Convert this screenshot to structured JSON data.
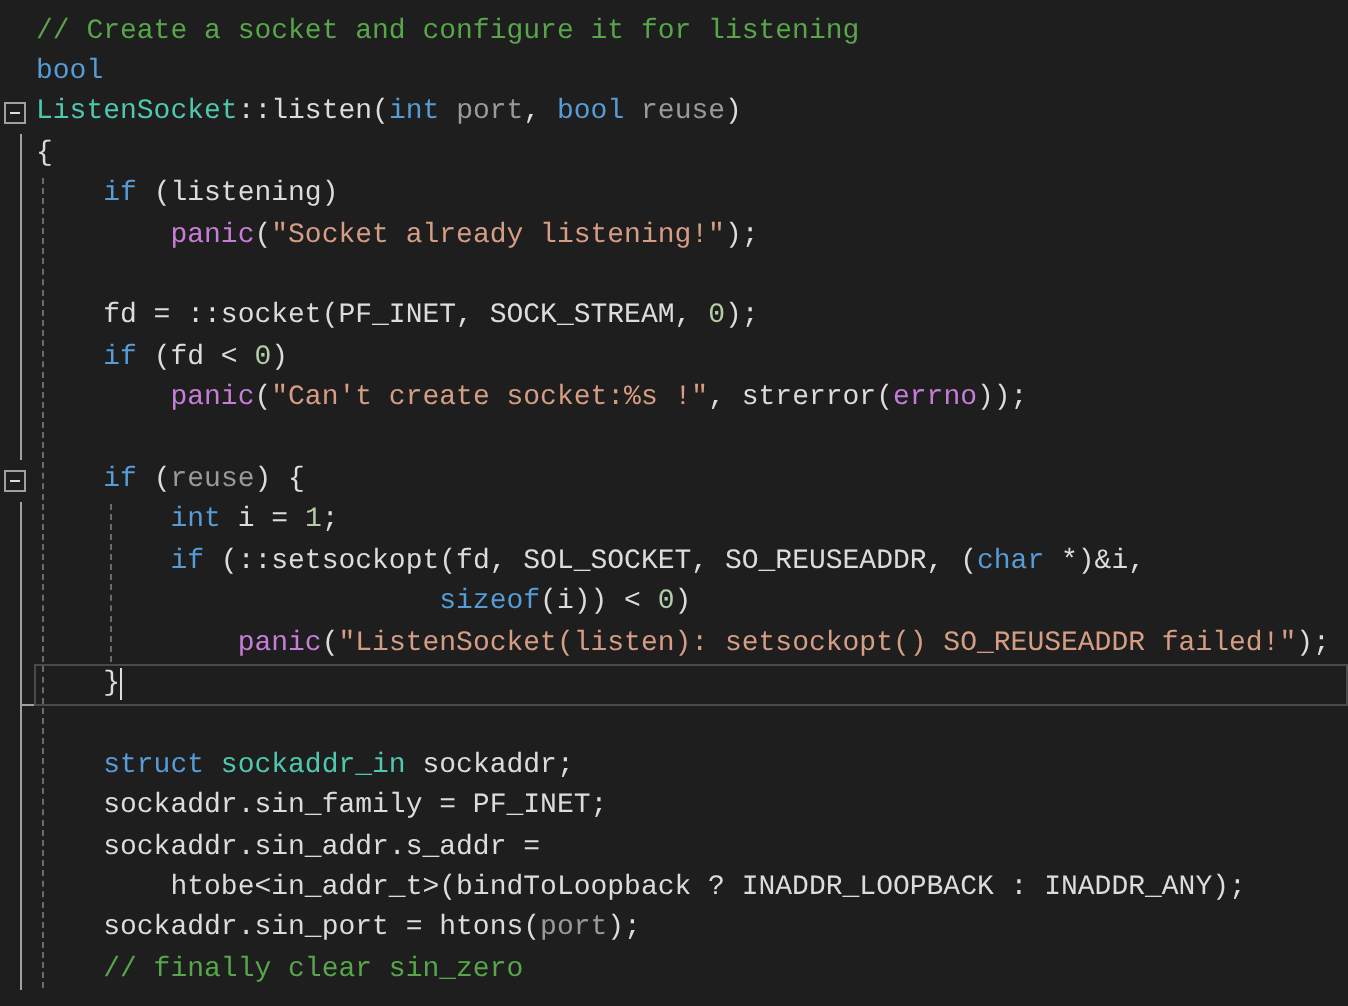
{
  "editor": {
    "lines": [
      {
        "tokens": [
          {
            "kind": "comment",
            "text": "// Create a socket and configure it for listening"
          }
        ]
      },
      {
        "tokens": [
          {
            "kind": "keyword",
            "text": "bool"
          }
        ]
      },
      {
        "fold_start": true,
        "tokens": [
          {
            "kind": "type",
            "text": "ListenSocket"
          },
          {
            "kind": "plain",
            "text": "::listen("
          },
          {
            "kind": "keyword",
            "text": "int"
          },
          {
            "kind": "param",
            "text": " port"
          },
          {
            "kind": "plain",
            "text": ", "
          },
          {
            "kind": "keyword",
            "text": "bool"
          },
          {
            "kind": "param",
            "text": " reuse"
          },
          {
            "kind": "plain",
            "text": ")"
          }
        ]
      },
      {
        "tokens": [
          {
            "kind": "plain",
            "text": "{"
          }
        ]
      },
      {
        "tokens": [
          {
            "kind": "keyword",
            "text": "    if"
          },
          {
            "kind": "plain",
            "text": " (listening)"
          }
        ]
      },
      {
        "tokens": [
          {
            "kind": "call",
            "text": "        panic"
          },
          {
            "kind": "plain",
            "text": "("
          },
          {
            "kind": "string",
            "text": "\"Socket already listening!\""
          },
          {
            "kind": "plain",
            "text": ");"
          }
        ]
      },
      {
        "blank": true
      },
      {
        "tokens": [
          {
            "kind": "plain",
            "text": "    fd = ::socket(PF_INET, SOCK_STREAM, "
          },
          {
            "kind": "number",
            "text": "0"
          },
          {
            "kind": "plain",
            "text": ");"
          }
        ]
      },
      {
        "tokens": [
          {
            "kind": "keyword",
            "text": "    if"
          },
          {
            "kind": "plain",
            "text": " (fd < "
          },
          {
            "kind": "number",
            "text": "0"
          },
          {
            "kind": "plain",
            "text": ")"
          }
        ]
      },
      {
        "tokens": [
          {
            "kind": "call",
            "text": "        panic"
          },
          {
            "kind": "plain",
            "text": "("
          },
          {
            "kind": "string",
            "text": "\"Can't create socket:%s !\""
          },
          {
            "kind": "plain",
            "text": ", strerror("
          },
          {
            "kind": "call",
            "text": "errno"
          },
          {
            "kind": "plain",
            "text": "));"
          }
        ]
      },
      {
        "blank": true
      },
      {
        "fold_start": true,
        "tokens": [
          {
            "kind": "keyword",
            "text": "    if"
          },
          {
            "kind": "plain",
            "text": " ("
          },
          {
            "kind": "param",
            "text": "reuse"
          },
          {
            "kind": "plain",
            "text": ") {"
          }
        ]
      },
      {
        "tokens": [
          {
            "kind": "keyword",
            "text": "        int"
          },
          {
            "kind": "plain",
            "text": " i = "
          },
          {
            "kind": "number",
            "text": "1"
          },
          {
            "kind": "plain",
            "text": ";"
          }
        ]
      },
      {
        "tokens": [
          {
            "kind": "keyword",
            "text": "        if"
          },
          {
            "kind": "plain",
            "text": " (::setsockopt(fd, SOL_SOCKET, SO_REUSEADDR, ("
          },
          {
            "kind": "keyword",
            "text": "char"
          },
          {
            "kind": "plain",
            "text": " *)&i,"
          }
        ]
      },
      {
        "tokens": [
          {
            "kind": "keyword",
            "text": "                        sizeof"
          },
          {
            "kind": "plain",
            "text": "(i)) < "
          },
          {
            "kind": "number",
            "text": "0"
          },
          {
            "kind": "plain",
            "text": ")"
          }
        ]
      },
      {
        "tokens": [
          {
            "kind": "call",
            "text": "            panic"
          },
          {
            "kind": "plain",
            "text": "("
          },
          {
            "kind": "string",
            "text": "\"ListenSocket(listen): setsockopt() SO_REUSEADDR failed!\""
          },
          {
            "kind": "plain",
            "text": ");"
          }
        ]
      },
      {
        "fold_end": true,
        "current": true,
        "tokens": [
          {
            "kind": "plain",
            "text": "    }"
          }
        ]
      },
      {
        "blank": true
      },
      {
        "tokens": [
          {
            "kind": "keyword",
            "text": "    struct"
          },
          {
            "kind": "type",
            "text": " sockaddr_in"
          },
          {
            "kind": "plain",
            "text": " sockaddr;"
          }
        ]
      },
      {
        "tokens": [
          {
            "kind": "plain",
            "text": "    sockaddr.sin_family = PF_INET;"
          }
        ]
      },
      {
        "tokens": [
          {
            "kind": "plain",
            "text": "    sockaddr.sin_addr.s_addr ="
          }
        ]
      },
      {
        "tokens": [
          {
            "kind": "plain",
            "text": "        htobe<in_addr_t>(bindToLoopback ? INADDR_LOOPBACK : INADDR_ANY);"
          }
        ]
      },
      {
        "tokens": [
          {
            "kind": "plain",
            "text": "    sockaddr.sin_port = htons("
          },
          {
            "kind": "param",
            "text": "port"
          },
          {
            "kind": "plain",
            "text": ");"
          }
        ]
      },
      {
        "tokens": [
          {
            "kind": "comment",
            "text": "    // finally clear sin_zero"
          }
        ]
      }
    ]
  }
}
